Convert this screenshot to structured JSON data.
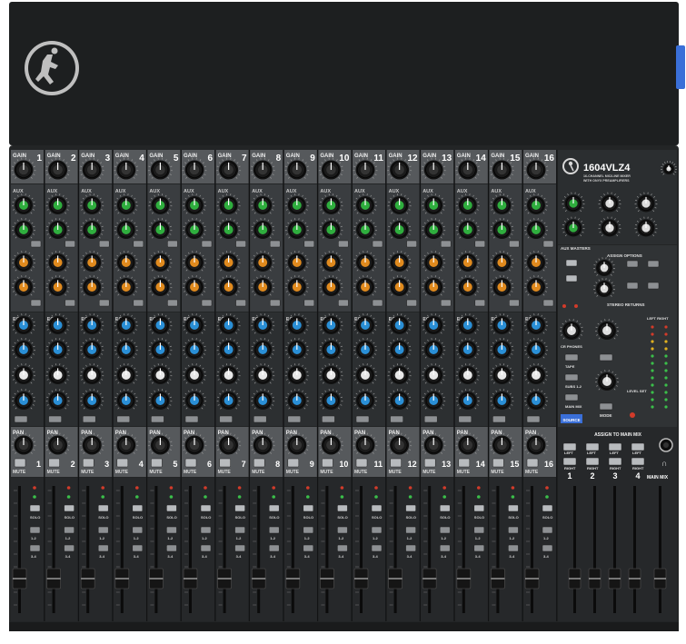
{
  "product": {
    "model": "1604VLZ4",
    "subtitle_line1": "16-CHANNEL MIC/LINE MIXER",
    "subtitle_line2": "WITH ONYX PREAMPLIFIERS"
  },
  "channels": [
    "1",
    "2",
    "3",
    "4",
    "5",
    "6",
    "7",
    "8",
    "9",
    "10",
    "11",
    "12",
    "13",
    "14",
    "15",
    "16"
  ],
  "strip_labels": {
    "gain": "GAIN",
    "aux": "AUX",
    "eq": "EQ",
    "pan": "PAN",
    "mute": "MUTE",
    "solo": "SOLO",
    "ol": "OL",
    "bus_12": "1-2",
    "bus_34": "3-4"
  },
  "master": {
    "aux_masters": "AUX MASTERS",
    "assign_options": "ASSIGN OPTIONS",
    "stereo_returns": "STEREO RETURNS",
    "phones": "CR PHONES",
    "tape": "TAPE",
    "subs": "SUBS 1-2",
    "main_mix": "MAIN MIX",
    "source": "SOURCE",
    "mode": "MODE",
    "level_set": "LEVEL SET",
    "meter_header": "LEFT  RIGHT",
    "assign_to_main_mix": "ASSIGN TO MAIN MIX",
    "left": "LEFT",
    "right": "RIGHT",
    "sub_numbers": [
      "1",
      "2",
      "3",
      "4"
    ],
    "main_mix_label": "MAIN MIX"
  },
  "colors": {
    "body": "#1f2122",
    "panel": "#3a3d40",
    "panel_light": "#56595c",
    "knob": "#1a1a1a",
    "aux_knob": "#2fae3e",
    "fx_knob": "#e08a1e",
    "eq_knob": "#2a8fd6",
    "mid_knob": "#e8e8e8",
    "blue_tab": "#3a6fd8"
  }
}
